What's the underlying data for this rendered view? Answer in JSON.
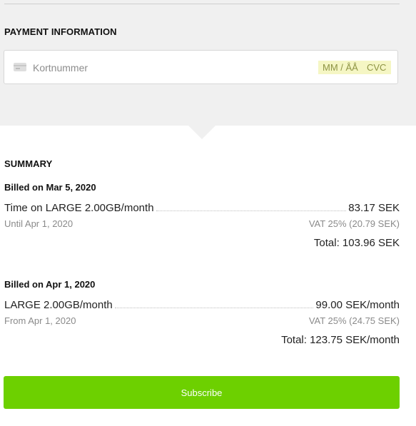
{
  "payment": {
    "title": "PAYMENT INFORMATION",
    "card_number_placeholder": "Kortnummer",
    "expiry_placeholder": "MM / ÅÅ",
    "cvc_placeholder": "CVC"
  },
  "summary": {
    "title": "SUMMARY",
    "blocks": [
      {
        "billed_on": "Billed on Mar 5, 2020",
        "item": "Time on LARGE 2.00GB/month",
        "amount": "83.17 SEK",
        "period": "Until Apr 1, 2020",
        "vat": "VAT 25% (20.79 SEK)",
        "total": "Total: 103.96 SEK"
      },
      {
        "billed_on": "Billed on Apr 1, 2020",
        "item": "LARGE 2.00GB/month",
        "amount": "99.00 SEK/month",
        "period": "From Apr 1, 2020",
        "vat": "VAT 25% (24.75 SEK)",
        "total": "Total: 123.75 SEK/month"
      }
    ]
  },
  "actions": {
    "subscribe_label": "Subscribe"
  },
  "colors": {
    "accent": "#6dd000",
    "panel_bg": "#f0f0f0",
    "highlight": "#f5f6c4"
  },
  "icons": {
    "card": "credit-card-icon"
  }
}
